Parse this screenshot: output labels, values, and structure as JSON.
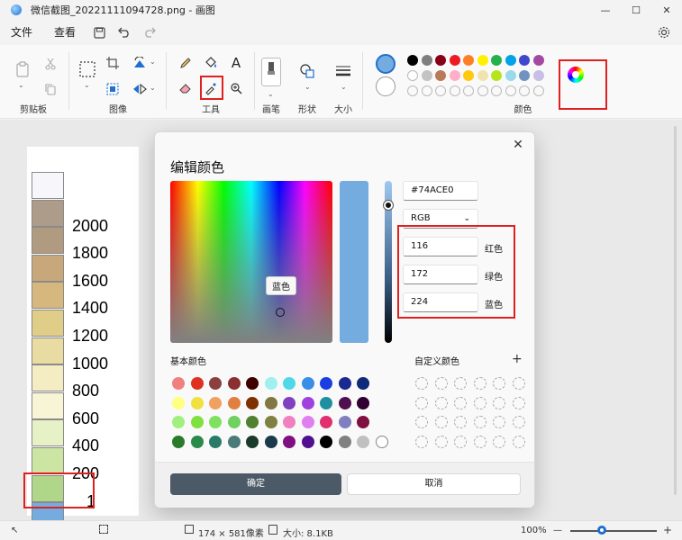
{
  "window": {
    "title": "微信截图_20221111094728.png - 画图",
    "min": "—",
    "max": "☐",
    "close": "✕"
  },
  "menu": {
    "file": "文件",
    "view": "查看"
  },
  "ribbon": {
    "groups": {
      "clipboard": "剪贴板",
      "image": "图像",
      "tools": "工具",
      "brushes": "画笔",
      "shapes": "形状",
      "size": "大小",
      "colors": "颜色"
    },
    "text_tool": "A",
    "primary_color": "#74ACE0",
    "secondary_color": "#ffffff",
    "palette_row1": [
      "#000000",
      "#7f7f7f",
      "#880015",
      "#ed1c24",
      "#ff7f27",
      "#fff200",
      "#22b14c",
      "#00a2e8",
      "#3f48cc",
      "#a349a4"
    ],
    "palette_row2": [
      "#ffffff",
      "#c3c3c3",
      "#b97a57",
      "#ffaec9",
      "#ffc90e",
      "#efe4b0",
      "#b5e61d",
      "#99d9ea",
      "#7092be",
      "#c8bfe7"
    ]
  },
  "canvas": {
    "legend": [
      {
        "color": "#f6f6fb",
        "label": ""
      },
      {
        "color": "#ad9c8a",
        "label": "2000"
      },
      {
        "color": "#b09a80",
        "label": "1800"
      },
      {
        "color": "#c8a87a",
        "label": "1600"
      },
      {
        "color": "#d6b87e",
        "label": "1400"
      },
      {
        "color": "#e0cd88",
        "label": "1200"
      },
      {
        "color": "#e9dca2",
        "label": "1000"
      },
      {
        "color": "#f4ecc3",
        "label": "800"
      },
      {
        "color": "#f8f4d6",
        "label": "600"
      },
      {
        "color": "#e6f2c6",
        "label": "400"
      },
      {
        "color": "#cce5a2",
        "label": "200"
      },
      {
        "color": "#b0d68a",
        "label": "1"
      },
      {
        "color": "#74ace0",
        "label": ""
      }
    ]
  },
  "dialog": {
    "title": "编辑颜色",
    "close": "✕",
    "tooltip": "蓝色",
    "preview_color": "#74ACE0",
    "hex_value": "#74ACE0",
    "mode": "RGB",
    "red_value": "116",
    "green_value": "172",
    "blue_value": "224",
    "red_label": "红色",
    "green_label": "绿色",
    "blue_label": "蓝色",
    "basic_colors_label": "基本颜色",
    "custom_colors_label": "自定义颜色",
    "add_label": "+",
    "basic_colors": [
      [
        "#f08080",
        "#e03020",
        "#8b4040",
        "#8b3030",
        "#400000",
        "#a0f0f0",
        "#50d8e8",
        "#3a8ee8",
        "#1a3fe0",
        "#1a2a90",
        "#102a7a"
      ],
      [
        "#ffff80",
        "#f0e040",
        "#f0a060",
        "#e08040",
        "#803000",
        "#807840",
        "#8040c0",
        "#a040e0",
        "#2090a0",
        "#501050",
        "#300030"
      ],
      [
        "#a0f080",
        "#80e040",
        "#80e060",
        "#70d060",
        "#508030",
        "#808040",
        "#f080c0",
        "#e080f0",
        "#e03070",
        "#8080c0",
        "#801040"
      ],
      [
        "#2a7a2a",
        "#2a8a4a",
        "#2a7a6a",
        "#4a7a7a",
        "#1a3a2a",
        "#1a3a4a",
        "#801080",
        "#501090",
        "#000000",
        "#808080",
        "#c0c0c0",
        "#ffffff"
      ]
    ],
    "ok": "确定",
    "cancel": "取消"
  },
  "status": {
    "dimensions": "174 × 581像素",
    "size": "大小: 8.1KB",
    "zoom": "100%",
    "zoom_out": "—",
    "zoom_in": "+"
  }
}
